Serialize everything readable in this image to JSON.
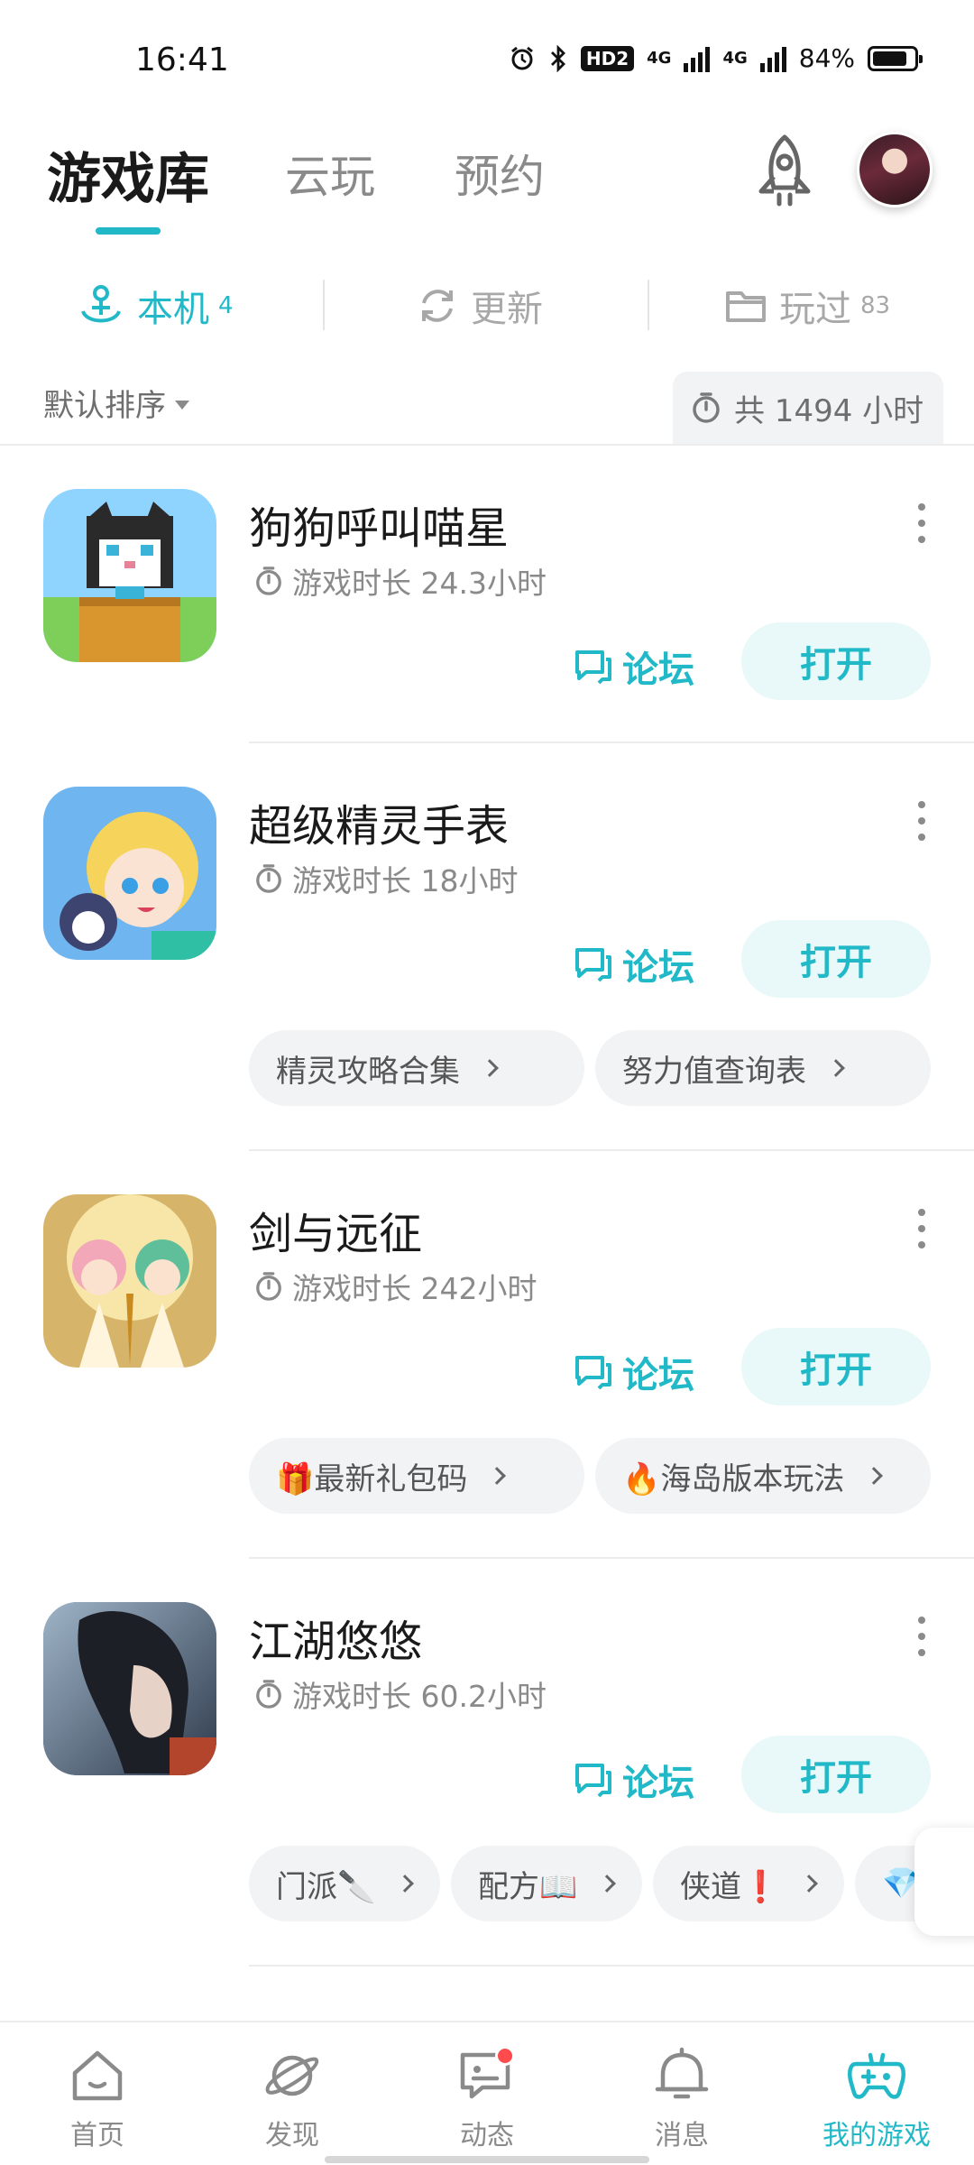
{
  "status_bar": {
    "time": "16:41",
    "hd": "HD2",
    "net1": "4G",
    "net2": "4G",
    "battery": "84%",
    "battery_level": 0.84
  },
  "header": {
    "tabs": [
      {
        "label": "游戏库",
        "active": true
      },
      {
        "label": "云玩",
        "active": false
      },
      {
        "label": "预约",
        "active": false
      }
    ]
  },
  "subtabs": [
    {
      "label": "本机",
      "count": "4",
      "active": true,
      "icon": "anchor-icon"
    },
    {
      "label": "更新",
      "count": "",
      "active": false,
      "icon": "refresh-icon"
    },
    {
      "label": "玩过",
      "count": "83",
      "active": false,
      "icon": "folder-icon"
    }
  ],
  "sort": {
    "label": "默认排序",
    "total": "共 1494 小时"
  },
  "games": [
    {
      "title": "狗狗呼叫喵星",
      "play_time": "游戏时长 24.3小时",
      "forum": "论坛",
      "open": "打开",
      "chips": []
    },
    {
      "title": "超级精灵手表",
      "play_time": "游戏时长 18小时",
      "forum": "论坛",
      "open": "打开",
      "chips": [
        "精灵攻略合集",
        "努力值查询表"
      ]
    },
    {
      "title": "剑与远征",
      "play_time": "游戏时长 242小时",
      "forum": "论坛",
      "open": "打开",
      "chips": [
        "🎁最新礼包码",
        "🔥海岛版本玩法"
      ]
    },
    {
      "title": "江湖悠悠",
      "play_time": "游戏时长 60.2小时",
      "forum": "论坛",
      "open": "打开",
      "chips": [
        "门派🔪",
        "配方📖",
        "侠道❗",
        "💎"
      ]
    }
  ],
  "bottom_nav": [
    {
      "label": "首页",
      "icon": "home-icon",
      "active": false
    },
    {
      "label": "发现",
      "icon": "planet-icon",
      "active": false
    },
    {
      "label": "动态",
      "icon": "chat-icon",
      "active": false,
      "badge": true
    },
    {
      "label": "消息",
      "icon": "bell-icon",
      "active": false
    },
    {
      "label": "我的游戏",
      "icon": "gamepad-icon",
      "active": true
    }
  ],
  "colors": {
    "accent": "#21b9c8",
    "open_bg": "#e9f8f9",
    "chip_bg": "#f2f3f5",
    "badge": "#ff4b4b"
  }
}
